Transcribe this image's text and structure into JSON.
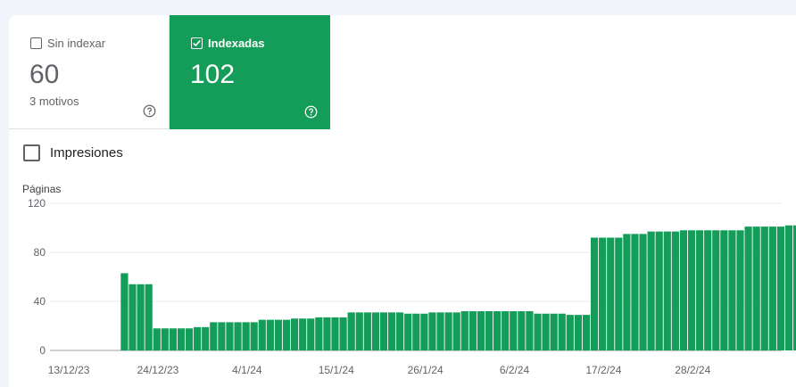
{
  "tiles": {
    "not_indexed": {
      "label": "Sin indexar",
      "value": "60",
      "subtitle": "3 motivos",
      "checked": false
    },
    "indexed": {
      "label": "Indexadas",
      "value": "102",
      "checked": true
    }
  },
  "impressions": {
    "label": "Impresiones",
    "checked": false
  },
  "colors": {
    "accent": "#139d58",
    "grid": "#e8eaed",
    "text_muted": "#5f6368"
  },
  "icons": {
    "help": "help-circle-icon",
    "check": "checkmark-icon"
  },
  "chart_data": {
    "type": "bar",
    "ylabel": "Páginas",
    "ylim": [
      0,
      120
    ],
    "yticks": [
      0,
      40,
      80,
      120
    ],
    "grid": true,
    "xtick_labels": [
      "13/12/23",
      "24/12/23",
      "4/1/24",
      "15/1/24",
      "26/1/24",
      "6/2/24",
      "17/2/24",
      "28/2/24"
    ],
    "xtick_positions": [
      0,
      11,
      22,
      33,
      44,
      55,
      66,
      77
    ],
    "series": [
      {
        "values": [
          0,
          0,
          0,
          0,
          63,
          54,
          54,
          54,
          18,
          18,
          18,
          18,
          18,
          19,
          19,
          23,
          23,
          23,
          23,
          23,
          23,
          25,
          25,
          25,
          25,
          26,
          26,
          26,
          27,
          27,
          27,
          27,
          31,
          31,
          31,
          31,
          31,
          31,
          31,
          30,
          30,
          30,
          31,
          31,
          31,
          31,
          32,
          32,
          32,
          32,
          32,
          32,
          32,
          32,
          32,
          30,
          30,
          30,
          30,
          29,
          29,
          29,
          92,
          92,
          92,
          92,
          95,
          95,
          95,
          97,
          97,
          97,
          97,
          98,
          98,
          98,
          98,
          98,
          98,
          98,
          98,
          101,
          101,
          101,
          101,
          101,
          102,
          102
        ]
      }
    ]
  }
}
